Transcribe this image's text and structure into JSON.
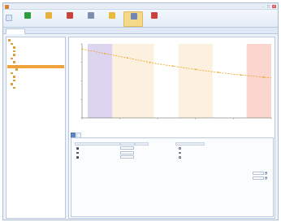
{
  "window": {
    "title": ""
  },
  "ribbon": {
    "file_label": "",
    "buttons": [
      {
        "label": "",
        "icon": "add-green-icon",
        "color": "#2e9d3a"
      },
      {
        "label": "",
        "icon": "folder-icon",
        "color": "#e8b23a"
      },
      {
        "label": "",
        "icon": "chart-red-icon",
        "color": "#c9433a"
      },
      {
        "label": "",
        "icon": "grid-icon",
        "color": "#7d8fb0"
      },
      {
        "label": "",
        "icon": "lightning-icon",
        "color": "#e9b93a"
      },
      {
        "label": "",
        "icon": "sigma-icon",
        "color": "#6f87b8"
      },
      {
        "label": "",
        "icon": "export-red-icon",
        "color": "#c9433a"
      }
    ],
    "active_index": 5
  },
  "tabstrip": {
    "tab_label": ""
  },
  "tree": {
    "nodes": [
      {
        "label": "",
        "level": 0
      },
      {
        "label": "",
        "level": 1
      },
      {
        "label": "",
        "level": 2
      },
      {
        "label": "",
        "level": 2
      },
      {
        "label": "",
        "level": 2
      },
      {
        "label": "",
        "level": 1
      },
      {
        "label": "",
        "level": 2
      },
      {
        "label": "",
        "level": 3,
        "selected": true
      },
      {
        "label": "",
        "level": 3
      },
      {
        "label": "",
        "level": 1
      },
      {
        "label": "",
        "level": 2
      },
      {
        "label": "",
        "level": 2
      },
      {
        "label": "",
        "level": 1
      },
      {
        "label": "",
        "level": 2
      }
    ]
  },
  "chart_data": {
    "type": "line",
    "title": "",
    "xlabel": "",
    "ylabel": "",
    "x_ticks": [
      "",
      "",
      "",
      "",
      "",
      ""
    ],
    "y_ticks": [
      "",
      "",
      "",
      "",
      ""
    ],
    "series": [
      {
        "x": [
          0.0,
          0.04,
          0.08,
          0.12,
          0.16,
          0.2,
          0.24,
          0.28,
          0.32,
          0.36,
          0.4,
          0.44,
          0.48,
          0.52,
          0.56,
          0.6,
          0.64,
          0.68,
          0.72,
          0.76,
          0.8,
          0.84,
          0.88,
          0.92,
          0.96,
          1.0
        ],
        "y": [
          0.93,
          0.91,
          0.89,
          0.87,
          0.85,
          0.83,
          0.81,
          0.79,
          0.77,
          0.75,
          0.73,
          0.715,
          0.7,
          0.685,
          0.67,
          0.655,
          0.64,
          0.627,
          0.615,
          0.603,
          0.59,
          0.58,
          0.57,
          0.56,
          0.55,
          0.54
        ],
        "color": "#f0a020"
      }
    ],
    "bands": [
      {
        "from": 0.03,
        "to": 0.16,
        "color": "#ddd4ef"
      },
      {
        "from": 0.16,
        "to": 0.38,
        "color": "#fbf1de"
      },
      {
        "from": 0.51,
        "to": 0.69,
        "color": "#fbf1de"
      },
      {
        "from": 0.87,
        "to": 1.0,
        "color": "#fbd6cf"
      }
    ],
    "xlim": [
      0,
      1
    ],
    "ylim": [
      0,
      1
    ],
    "grid": false
  },
  "bottom_tabs": {
    "tabs": [
      "",
      ""
    ],
    "active_index": 0
  },
  "panel": {
    "group1_title": "",
    "group1_headers": [
      "",
      "",
      "",
      ""
    ],
    "group1_rows": [
      {
        "label": "",
        "value": "",
        "unit": "",
        "checked": true
      },
      {
        "label": "",
        "value": "",
        "unit": "",
        "checked": true
      },
      {
        "label": "",
        "value": "",
        "unit": "",
        "checked": true
      }
    ],
    "group2_title": "",
    "group2_options": [
      "",
      "",
      ""
    ],
    "group2_selected": 2,
    "group3_title": "",
    "group3_rows": [
      {
        "label": "",
        "value": ""
      },
      {
        "label": "",
        "value": ""
      }
    ]
  }
}
